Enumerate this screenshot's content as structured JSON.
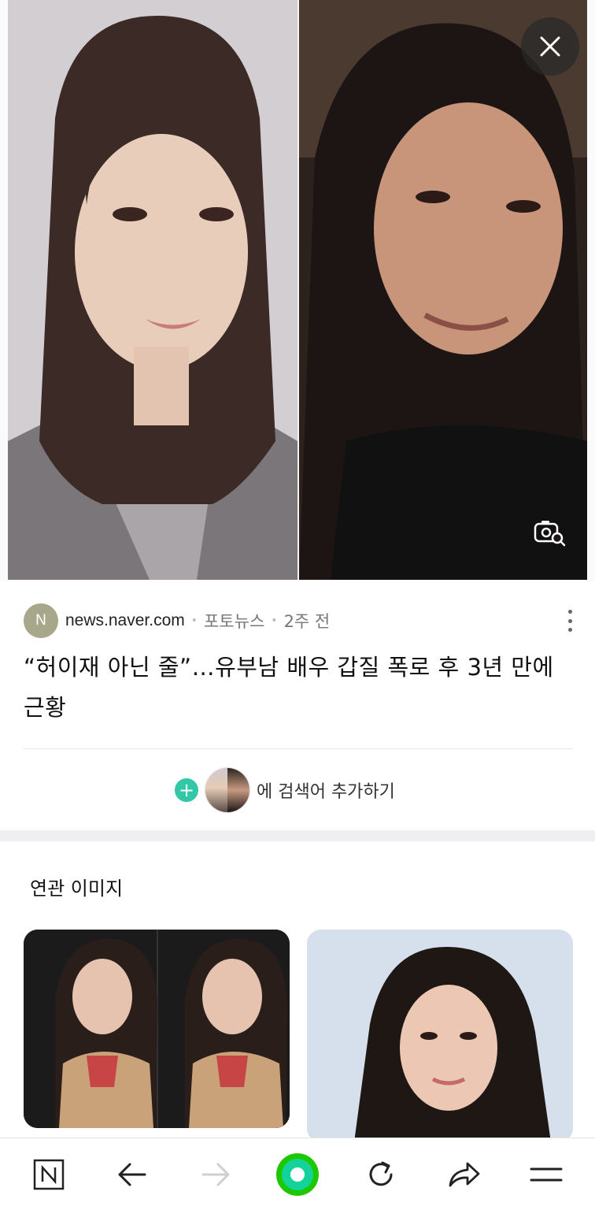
{
  "viewer": {
    "close_icon": "close-icon",
    "lens_icon": "image-search-icon"
  },
  "article": {
    "source_logo_letter": "N",
    "source_domain": "news.naver.com",
    "category": "포토뉴스",
    "time": "2주 전",
    "headline": "“허이재 아닌 줄”…유부남 배우 갑질 폭로 후 3년 만에 근황",
    "more_icon": "more-vertical-icon"
  },
  "add_search": {
    "plus": "+",
    "label": "에 검색어 추가하기"
  },
  "related": {
    "title": "연관 이미지"
  },
  "bottom_bar": {
    "items": [
      "naver-home-icon",
      "back-arrow-icon",
      "forward-arrow-icon",
      "green-dot-icon",
      "refresh-icon",
      "share-icon",
      "menu-icon"
    ]
  },
  "colors": {
    "accent_green": "#33c7a8",
    "logo_bg": "#a7a78b",
    "naver_green": "#1ec800"
  }
}
